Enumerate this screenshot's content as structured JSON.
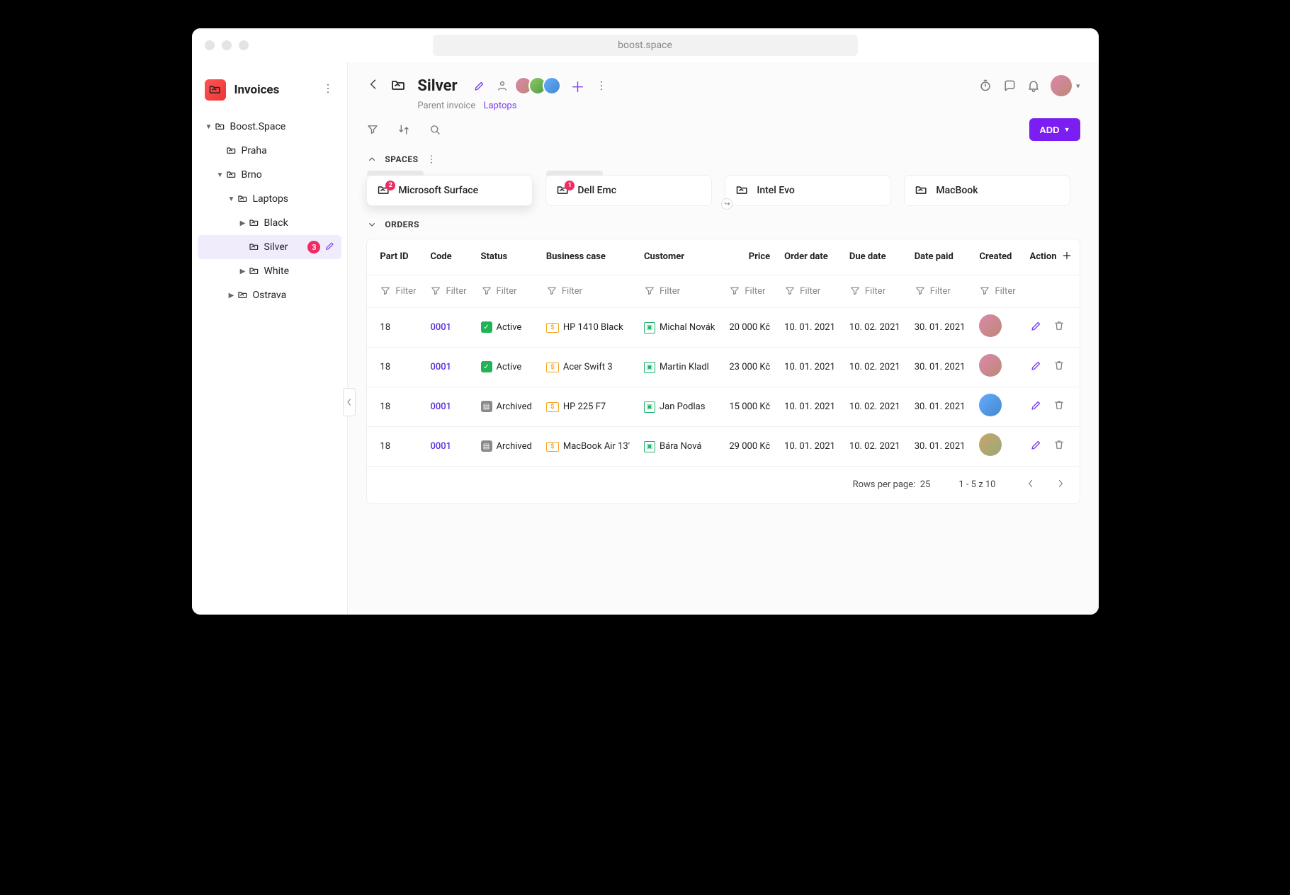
{
  "addressbar": "boost.space",
  "sidebar": {
    "title": "Invoices",
    "tree": {
      "root": "Boost.Space",
      "praha": "Praha",
      "brno": "Brno",
      "laptops": "Laptops",
      "black": "Black",
      "silver": "Silver",
      "silver_badge": "3",
      "white": "White",
      "ostrava": "Ostrava"
    }
  },
  "header": {
    "title": "Silver",
    "parent_label": "Parent invoice",
    "parent_link": "Laptops",
    "add_button": "ADD"
  },
  "sections": {
    "spaces": "SPACES",
    "orders": "ORDERS"
  },
  "spaces": [
    {
      "label": "Microsoft Surface",
      "badge": "2",
      "shadow": true,
      "tab": true
    },
    {
      "label": "Dell Emc",
      "badge": "1",
      "shadow": false,
      "tab": true
    },
    {
      "label": "Intel Evo",
      "badge": null,
      "shadow": false,
      "tab": false,
      "link": true
    },
    {
      "label": "MacBook",
      "badge": null,
      "shadow": false,
      "tab": false
    }
  ],
  "table": {
    "columns": {
      "part_id": "Part ID",
      "code": "Code",
      "status": "Status",
      "business_case": "Business case",
      "customer": "Customer",
      "price": "Price",
      "order_date": "Order date",
      "due_date": "Due date",
      "date_paid": "Date paid",
      "created": "Created",
      "action": "Action"
    },
    "filter_label": "Filter",
    "rows": [
      {
        "part_id": "18",
        "code": "0001",
        "status": "Active",
        "status_kind": "active",
        "business_case": "HP 1410 Black",
        "customer": "Michal Novák",
        "price": "20 000 Kč",
        "order_date": "10. 01. 2021",
        "due_date": "10. 02. 2021",
        "date_paid": "30. 01. 2021",
        "avatar": "av1"
      },
      {
        "part_id": "18",
        "code": "0001",
        "status": "Active",
        "status_kind": "active",
        "business_case": "Acer Swift 3",
        "customer": "Martin Kladl",
        "price": "23 000 Kč",
        "order_date": "10. 01. 2021",
        "due_date": "10. 02. 2021",
        "date_paid": "30. 01. 2021",
        "avatar": "av1"
      },
      {
        "part_id": "18",
        "code": "0001",
        "status": "Archived",
        "status_kind": "archived",
        "business_case": "HP 225 F7",
        "customer": "Jan Podlas",
        "price": "15 000 Kč",
        "order_date": "10. 01. 2021",
        "due_date": "10. 02. 2021",
        "date_paid": "30. 01. 2021",
        "avatar": "av3"
      },
      {
        "part_id": "18",
        "code": "0001",
        "status": "Archived",
        "status_kind": "archived",
        "business_case": "MacBook Air 13'",
        "customer": "Bára Nová",
        "price": "29 000 Kč",
        "order_date": "10. 01. 2021",
        "due_date": "10. 02. 2021",
        "date_paid": "30. 01. 2021",
        "avatar": "av4"
      }
    ],
    "footer": {
      "rows_per_page_label": "Rows per page:",
      "rows_per_page_value": "25",
      "range": "1 - 5 z 10"
    }
  }
}
